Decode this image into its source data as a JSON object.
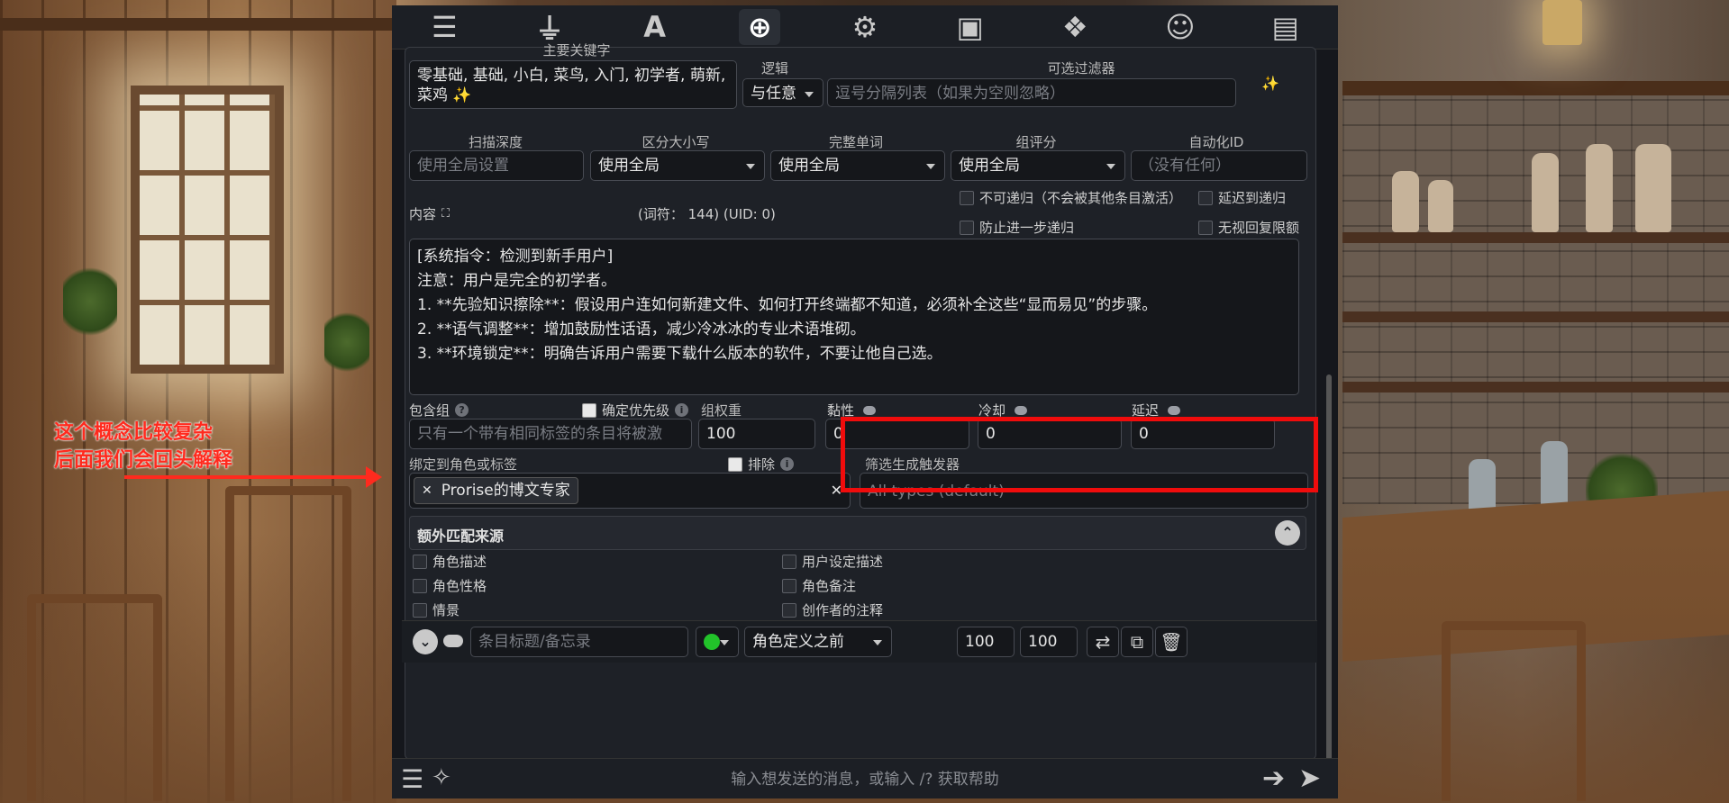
{
  "annotation": {
    "line1": "这个概念比较复杂",
    "line2": "后面我们会回头解释"
  },
  "topbar": {
    "icons": [
      "sliders-icon",
      "plug-icon",
      "font-icon",
      "book-globe-icon",
      "user-gear-icon",
      "image-icon",
      "cubes-icon",
      "smile-icon",
      "id-card-icon"
    ],
    "active_index": 3
  },
  "keywords": {
    "label": "主要关键字",
    "value": "零基础, 基础, 小白, 菜鸟, 入门, 初学者, 萌新, 菜鸡",
    "logic_label": "逻辑",
    "logic_value": "与任意",
    "filter_label": "可选过滤器",
    "filter_placeholder": "逗号分隔列表（如果为空则忽略）"
  },
  "settings": {
    "scan_depth_label": "扫描深度",
    "scan_depth_placeholder": "使用全局设置",
    "case_label": "区分大小写",
    "case_value": "使用全局",
    "whole_word_label": "完整单词",
    "whole_word_value": "使用全局",
    "group_score_label": "组评分",
    "group_score_value": "使用全局",
    "automation_label": "自动化ID",
    "automation_placeholder": "（没有任何）"
  },
  "content": {
    "label": "内容",
    "tokens": "(词符：  144)  (UID: 0)",
    "lines": [
      "[系统指令：检测到新手用户]",
      "注意：用户是完全的初学者。",
      "1. **先验知识擦除**：假设用户连如何新建文件、如何打开终端都不知道，必须补全这些“显而易见”的步骤。",
      "2. **语气调整**：增加鼓励性话语，减少冷冰冰的专业术语堆砌。",
      "3. **环境锁定**：明确告诉用户需要下载什么版本的软件，不要让他自己选。"
    ],
    "cb_non_recursive": "不可递归（不会被其他条目激活）",
    "cb_delay_recursion": "延迟到递归",
    "cb_prevent_recursion": "防止进一步递归",
    "cb_ignore_budget": "无视回复限额"
  },
  "group": {
    "label": "包含组",
    "placeholder": "只有一个带有相同标签的条目将被激",
    "prioritize_label": "确定优先级",
    "weight_label": "组权重",
    "weight_value": "100",
    "sticky_label": "黏性",
    "sticky_value": "0",
    "cooldown_label": "冷却",
    "cooldown_value": "0",
    "delay_label": "延迟",
    "delay_value": "0"
  },
  "binding": {
    "label": "绑定到角色或标签",
    "exclude_label": "排除",
    "tag": "Prorise的博文专家",
    "trigger_label": "筛选生成触发器",
    "trigger_placeholder": "All types (default)"
  },
  "sources": {
    "title": "额外匹配来源",
    "left": [
      "角色描述",
      "角色性格",
      "情景"
    ],
    "right": [
      "用户设定描述",
      "角色备注",
      "创作者的注释"
    ]
  },
  "entry": {
    "title_placeholder": "条目标题/备忘录",
    "position_value": "角色定义之前",
    "order": "100",
    "probability": "100",
    "status_color": "#22c32a"
  },
  "chat": {
    "placeholder": "输入想发送的消息，或输入 /? 获取帮助"
  }
}
